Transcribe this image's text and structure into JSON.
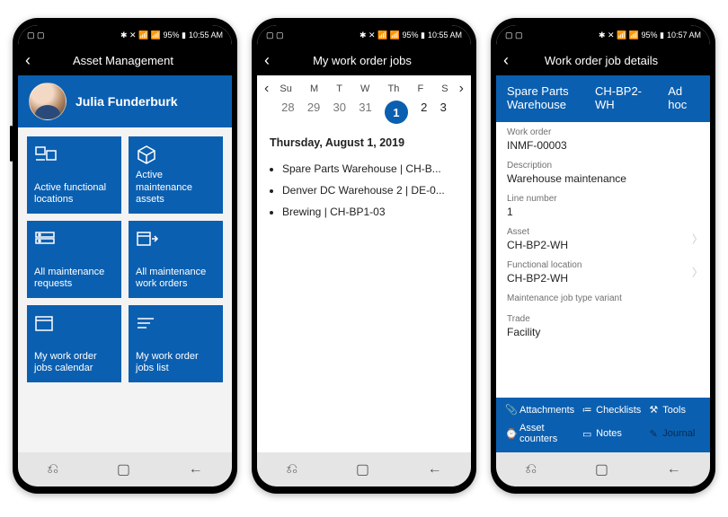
{
  "status": {
    "left_icons": "▢ ▢",
    "right_icons": "✱ ✕ 📶 📶 95% ▮",
    "time1": "10:55 AM",
    "time2": "10:55 AM",
    "time3": "10:57 AM"
  },
  "phone1": {
    "title": "Asset Management",
    "user": "Julia Funderburk",
    "tiles": [
      {
        "label": "Active functional locations"
      },
      {
        "label": "Active maintenance assets"
      },
      {
        "label": "All maintenance requests"
      },
      {
        "label": "All maintenance work orders"
      },
      {
        "label": "My work order jobs calendar"
      },
      {
        "label": "My work order jobs list"
      }
    ]
  },
  "phone2": {
    "title": "My work order jobs",
    "days": [
      "Su",
      "M",
      "T",
      "W",
      "Th",
      "F",
      "S"
    ],
    "nums": [
      "28",
      "29",
      "30",
      "31",
      "1",
      "2",
      "3"
    ],
    "date_heading": "Thursday, August 1, 2019",
    "events": [
      "Spare Parts Warehouse | CH-B...",
      "Denver DC Warehouse 2 | DE-0...",
      "Brewing | CH-BP1-03"
    ]
  },
  "phone3": {
    "title": "Work order job details",
    "tabs": [
      "Spare Parts Warehouse",
      "CH-BP2-WH",
      "Ad hoc"
    ],
    "fields": [
      {
        "label": "Work order",
        "value": "INMF-00003"
      },
      {
        "label": "Description",
        "value": "Warehouse maintenance"
      },
      {
        "label": "Line number",
        "value": "1"
      },
      {
        "label": "Asset",
        "value": "CH-BP2-WH",
        "chev": true
      },
      {
        "label": "Functional location",
        "value": "CH-BP2-WH",
        "chev": true
      },
      {
        "label": "Maintenance job type variant",
        "value": ""
      },
      {
        "label": "Trade",
        "value": "Facility"
      }
    ],
    "actions": [
      {
        "icon": "📎",
        "label": "Attachments"
      },
      {
        "icon": "≔",
        "label": "Checklists"
      },
      {
        "icon": "⚒",
        "label": "Tools"
      },
      {
        "icon": "⌚",
        "label": "Asset counters"
      },
      {
        "icon": "▭",
        "label": "Notes"
      },
      {
        "icon": "✎",
        "label": "Journal",
        "dim": true
      }
    ]
  }
}
